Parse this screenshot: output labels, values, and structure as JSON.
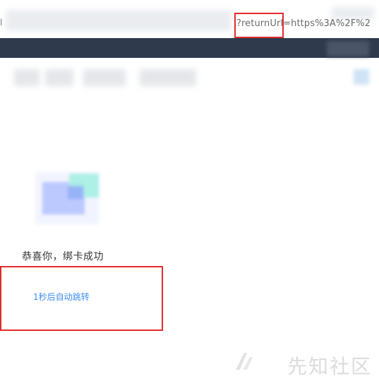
{
  "address_bar": {
    "prefix": "l",
    "url_visible": "?returnUrl=https%3A%2F%2"
  },
  "main": {
    "success_message": "恭喜你，绑卡成功",
    "redirect_message": "1秒后自动跳转"
  },
  "watermark": {
    "text": "先知社区"
  },
  "colors": {
    "header_bar": "#2f3a4d",
    "highlight_border": "#e02b2b",
    "link_blue": "#3d8ef0"
  }
}
